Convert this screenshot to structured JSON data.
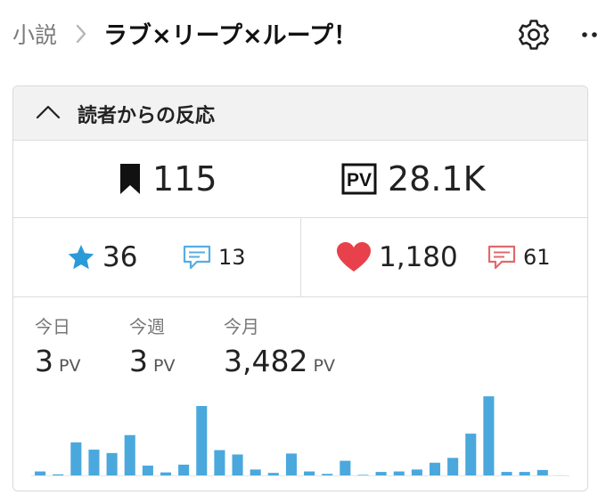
{
  "header": {
    "breadcrumb": "小説",
    "title": "ラブ×リープ×ループ！"
  },
  "panel": {
    "title": "読者からの反応",
    "bookmarks": "115",
    "pv_total": "28.1K",
    "stars": "36",
    "star_comments": "13",
    "hearts": "1,180",
    "heart_comments": "61",
    "today_label": "今日",
    "today_value": "3",
    "week_label": "今週",
    "week_value": "3",
    "month_label": "今月",
    "month_value": "3,482",
    "unit": "PV"
  },
  "colors": {
    "bar": "#4aa8dd",
    "star": "#2b9ad8",
    "heart": "#e8414b",
    "comment_blue": "#55aee0",
    "comment_red": "#e06a6a"
  },
  "chart_data": {
    "type": "bar",
    "values": [
      1,
      0.4,
      7,
      5.5,
      4.8,
      8.5,
      2.2,
      0.8,
      2.4,
      14.5,
      5.4,
      4.5,
      1.4,
      0.7,
      4.7,
      1,
      0.5,
      3.2,
      0.3,
      0.9,
      1,
      1.4,
      2.8,
      3.8,
      8.8,
      16.5,
      0.9,
      0.9,
      1.3,
      0.2
    ],
    "ylim": [
      0,
      18
    ]
  }
}
